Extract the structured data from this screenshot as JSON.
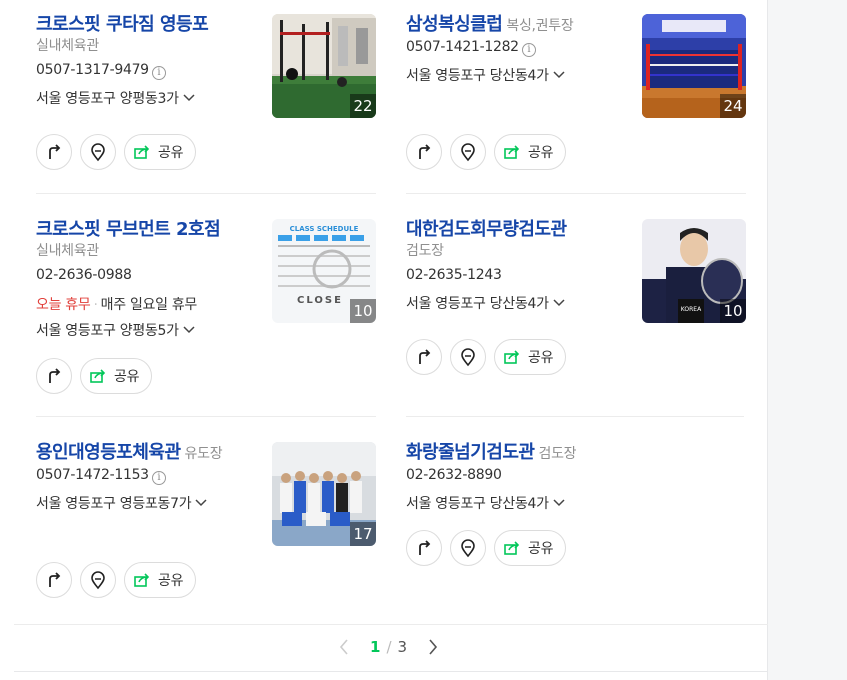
{
  "places": [
    {
      "name": "크로스핏 쿠타짐 영등포",
      "category": "실내체육관",
      "phone": "0507-1317-9479",
      "address": "서울 영등포구 양평동3가",
      "photo_count": "22"
    },
    {
      "name": "삼성복싱클럽",
      "category": "복싱,권투장",
      "phone": "0507-1421-1282",
      "address": "서울 영등포구 당산동4가",
      "photo_count": "24"
    },
    {
      "name": "크로스핏 무브먼트 2호점",
      "category": "실내체육관",
      "phone": "02-2636-0988",
      "status": "오늘 휴무",
      "hours": "매주 일요일 휴무",
      "address": "서울 영등포구 양평동5가",
      "photo_count": "10"
    },
    {
      "name": "대한검도회무량검도관",
      "category": "검도장",
      "phone": "02-2635-1243",
      "address": "서울 영등포구 당산동4가",
      "photo_count": "10"
    },
    {
      "name": "용인대영등포체육관",
      "category": "유도장",
      "phone": "0507-1472-1153",
      "address": "서울 영등포구 영등포동7가",
      "photo_count": "17"
    },
    {
      "name": "화랑줄넘기검도관",
      "category": "검도장",
      "phone": "02-2632-8890",
      "address": "서울 영등포구 당산동4가"
    }
  ],
  "labels": {
    "share": "공유",
    "info": "i",
    "sep": "·"
  },
  "thumb_text": {
    "schedule": "CLASS SCHEDULE",
    "close": "CLOSE",
    "korea": "KOREA"
  },
  "pagination": {
    "current": "1",
    "slash": "/",
    "total": "3"
  },
  "colors": {
    "title": "#1646a8",
    "closed": "#e1403b",
    "accent": "#03c75a"
  },
  "icons": [
    "directions-icon",
    "map-pin-icon",
    "share-icon",
    "info-icon",
    "chevron-down-icon",
    "chevron-left-icon",
    "chevron-right-icon"
  ]
}
